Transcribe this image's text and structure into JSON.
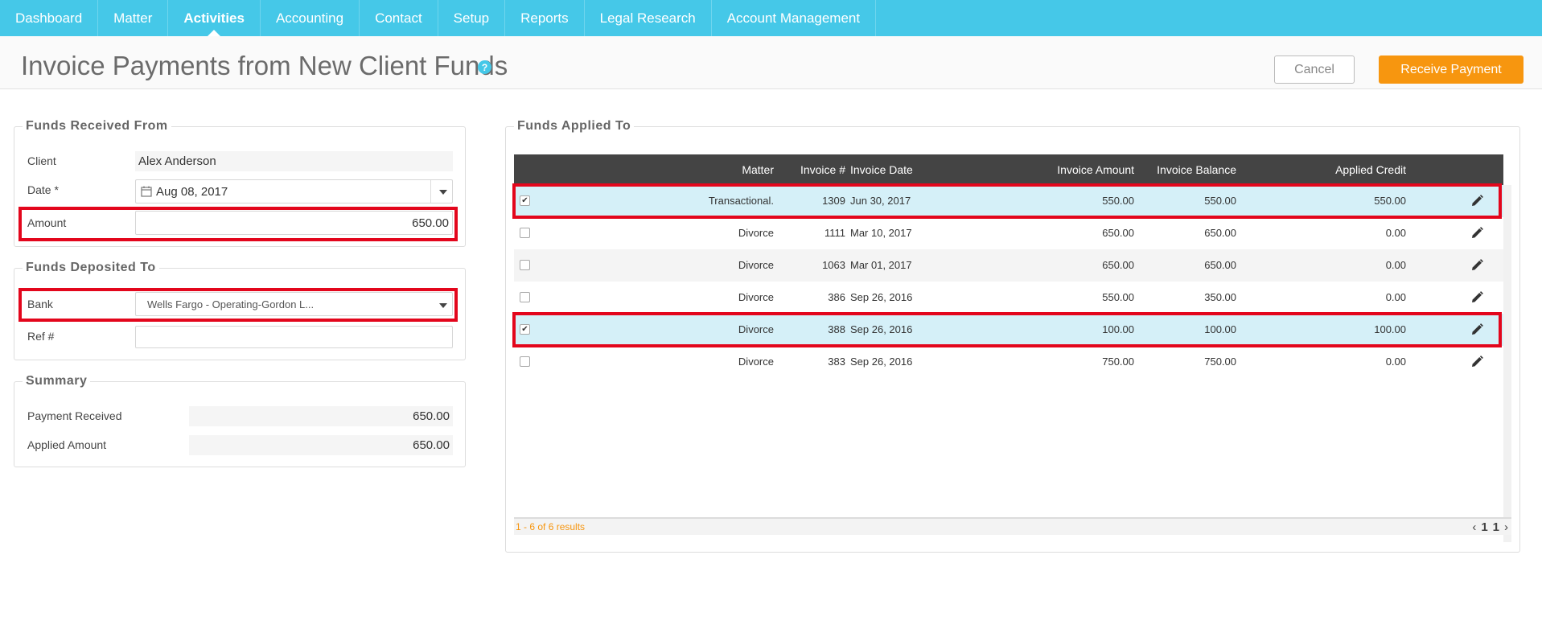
{
  "nav": {
    "items": [
      {
        "label": "Dashboard"
      },
      {
        "label": "Matter"
      },
      {
        "label": "Activities"
      },
      {
        "label": "Accounting"
      },
      {
        "label": "Contact"
      },
      {
        "label": "Setup"
      },
      {
        "label": "Reports"
      },
      {
        "label": "Legal Research"
      },
      {
        "label": "Account Management"
      }
    ],
    "active": "Activities"
  },
  "header": {
    "title": "Invoice Payments from New Client Funds",
    "help_icon": "question-circle-icon",
    "cancel_label": "Cancel",
    "receive_label": "Receive Payment"
  },
  "funds_received": {
    "legend": "Funds Received From",
    "client_label": "Client",
    "client_value": "Alex Anderson",
    "date_label": "Date *",
    "date_value": "Aug 08, 2017",
    "amount_label": "Amount",
    "amount_value": "650.00"
  },
  "funds_deposited": {
    "legend": "Funds Deposited To",
    "bank_label": "Bank",
    "bank_value": "Wells Fargo - Operating-Gordon L...",
    "ref_label": "Ref #",
    "ref_value": ""
  },
  "summary": {
    "legend": "Summary",
    "received_label": "Payment Received",
    "received_value": "650.00",
    "applied_label": "Applied Amount",
    "applied_value": "650.00"
  },
  "applied": {
    "legend": "Funds Applied To",
    "columns": {
      "matter": "Matter",
      "invoice_no": "Invoice #",
      "invoice_date": "Invoice Date",
      "invoice_amount": "Invoice Amount",
      "invoice_balance": "Invoice Balance",
      "applied_credit": "Applied Credit"
    },
    "rows": [
      {
        "checked": true,
        "matter": "Transactional.",
        "invoice_no": "1309",
        "invoice_date": "Jun 30, 2017",
        "invoice_amount": "550.00",
        "invoice_balance": "550.00",
        "applied_credit": "550.00"
      },
      {
        "checked": false,
        "matter": "Divorce",
        "invoice_no": "1111",
        "invoice_date": "Mar 10, 2017",
        "invoice_amount": "650.00",
        "invoice_balance": "650.00",
        "applied_credit": "0.00"
      },
      {
        "checked": false,
        "matter": "Divorce",
        "invoice_no": "1063",
        "invoice_date": "Mar 01, 2017",
        "invoice_amount": "650.00",
        "invoice_balance": "650.00",
        "applied_credit": "0.00"
      },
      {
        "checked": false,
        "matter": "Divorce",
        "invoice_no": "386",
        "invoice_date": "Sep 26, 2016",
        "invoice_amount": "550.00",
        "invoice_balance": "350.00",
        "applied_credit": "0.00"
      },
      {
        "checked": true,
        "matter": "Divorce",
        "invoice_no": "388",
        "invoice_date": "Sep 26, 2016",
        "invoice_amount": "100.00",
        "invoice_balance": "100.00",
        "applied_credit": "100.00"
      },
      {
        "checked": false,
        "matter": "Divorce",
        "invoice_no": "383",
        "invoice_date": "Sep 26, 2016",
        "invoice_amount": "750.00",
        "invoice_balance": "750.00",
        "applied_credit": "0.00"
      }
    ],
    "results_text": "1 - 6 of 6 results",
    "pager": {
      "prev": "‹",
      "page": "1",
      "total": "1",
      "next": "›"
    }
  },
  "colors": {
    "nav_bg": "#45c8e8",
    "accent_orange": "#f7960f",
    "highlight_red": "#e3061c",
    "selected_row": "#d5f0f8",
    "table_header": "#444444"
  }
}
